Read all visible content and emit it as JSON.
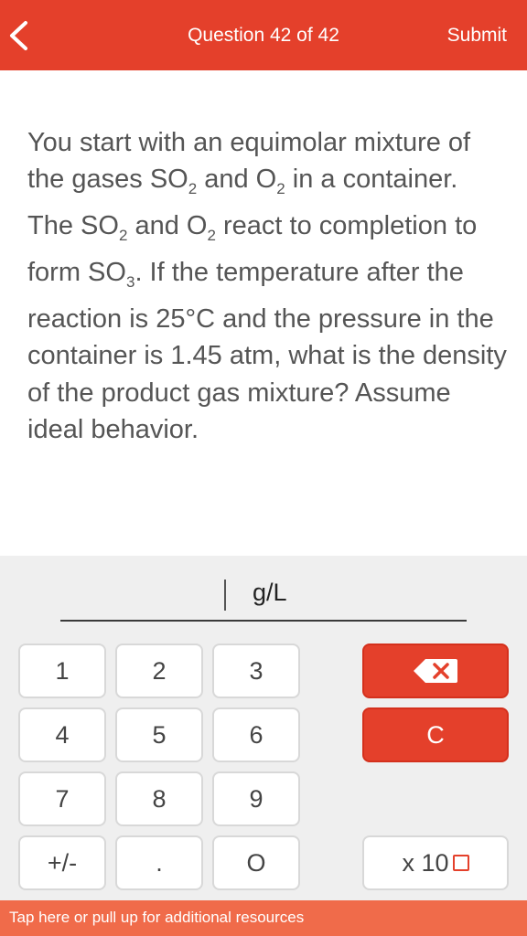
{
  "header": {
    "title": "Question 42 of 42",
    "submit_label": "Submit",
    "back_icon": "chevron-left-icon"
  },
  "question": {
    "text_html": "You start with an equimolar mixture of the gases SO<sub style=\"font-size:17px;\">2</sub> and O<sub style=\"font-size:17px;\">2</sub> in a container. The SO<sub style=\"font-size:17px;\">2</sub> and O<sub style=\"font-size:17px;\">2</sub> react to completion to form SO<sub style=\"font-size:17px;\">3</sub>. If the temperature after the reaction is 25°C and the pressure in the container is 1.45 atm, what is the density of the product gas mixture? Assume ideal behavior."
  },
  "answer": {
    "value": "",
    "unit": "g/L"
  },
  "keypad": {
    "k1": "1",
    "k2": "2",
    "k3": "3",
    "k4": "4",
    "k5": "5",
    "k6": "6",
    "k7": "7",
    "k8": "8",
    "k9": "9",
    "plusminus": "+/-",
    "decimal": ".",
    "k0": "O",
    "clear": "C",
    "x10": "x 10",
    "backspace_icon": "backspace-icon"
  },
  "colors": {
    "accent": "#e4402b",
    "bottom_bar": "#f06b4a"
  },
  "footer": {
    "text": "Tap here or pull up for additional resources"
  }
}
